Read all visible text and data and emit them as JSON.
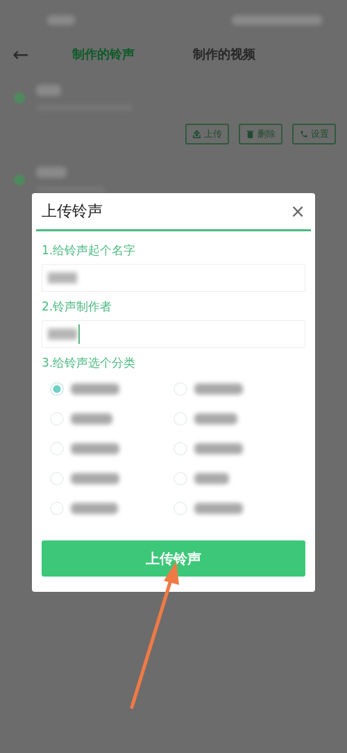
{
  "header": {
    "back": "←",
    "tabs": [
      {
        "label": "制作的铃声",
        "selected": true
      },
      {
        "label": "制作的视频",
        "selected": false
      }
    ]
  },
  "item_actions": [
    {
      "kind": "upload",
      "label": "上传"
    },
    {
      "kind": "delete",
      "label": "删除"
    },
    {
      "kind": "call",
      "label": "设置"
    }
  ],
  "dialog": {
    "title": "上传铃声",
    "close": "×",
    "name_label": "1.给铃声起个名字",
    "author_label": "2.铃声制作者",
    "category_label": "3.给铃声选个分类",
    "categories": [
      {
        "selected": true
      },
      {
        "selected": false
      },
      {
        "selected": false
      },
      {
        "selected": false
      },
      {
        "selected": false
      },
      {
        "selected": false
      },
      {
        "selected": false
      },
      {
        "selected": false
      },
      {
        "selected": false
      },
      {
        "selected": false
      }
    ],
    "submit": "上传铃声"
  }
}
